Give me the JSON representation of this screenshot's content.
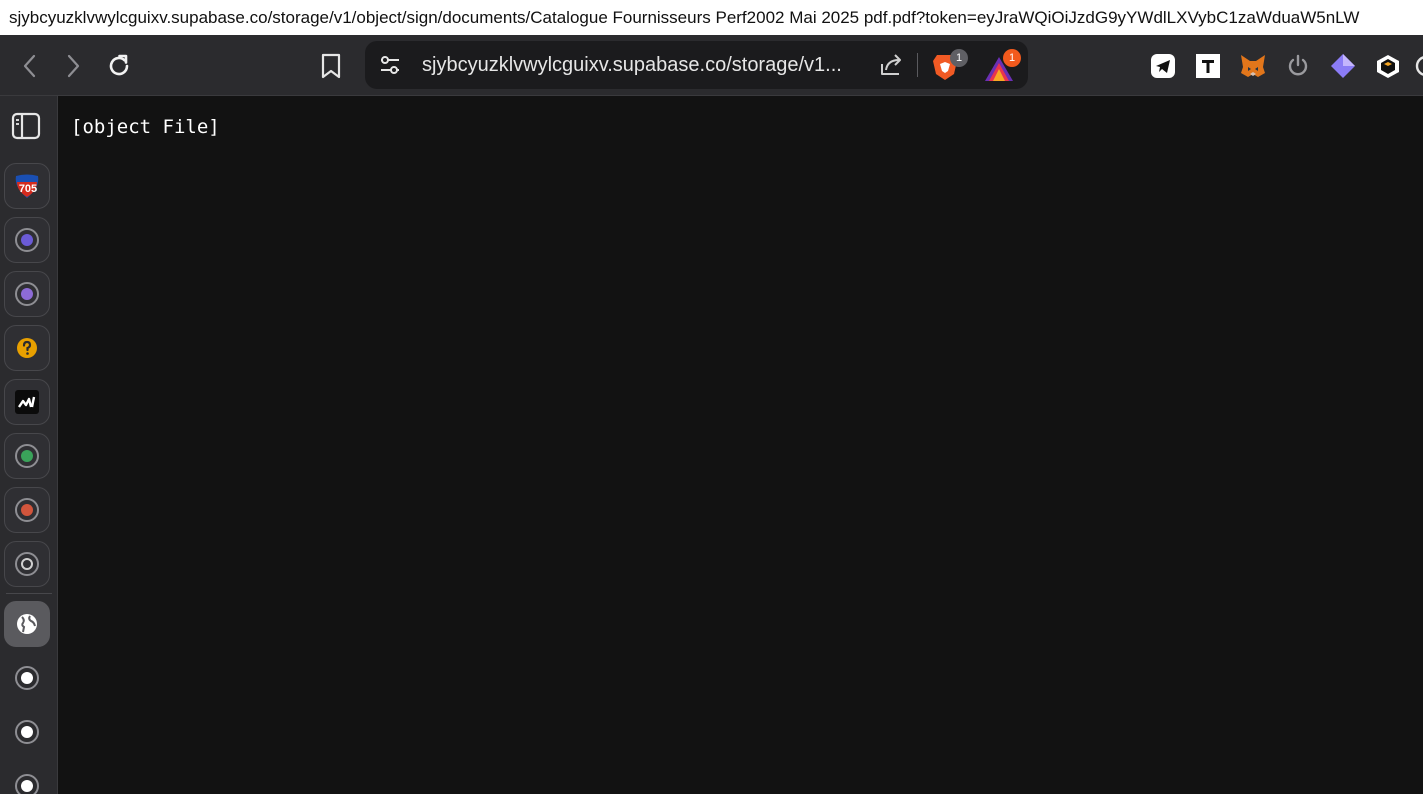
{
  "window": {
    "title": "sjybcyuzklvwylcguixv.supabase.co/storage/v1/object/sign/documents/Catalogue Fournisseurs Perf2002  Mai 2025 pdf.pdf?token=eyJraWQiOiJzdG9yYWdlLXVybC1zaWduaW5nLW"
  },
  "toolbar": {
    "back_icon": "chevron-left-icon",
    "forward_icon": "chevron-right-icon",
    "reload_icon": "reload-icon",
    "bookmark_icon": "bookmark-icon",
    "url": "sjybcyuzklvwylcguixv.supabase.co/storage/v1...",
    "shields_badge": "1",
    "rewards_badge": "1",
    "extensions": [
      "telegram-icon",
      "typora-t-icon",
      "metamask-fox-icon",
      "power-icon",
      "diamond-icon",
      "cube-wallet-icon"
    ]
  },
  "sidebar": {
    "items": [
      {
        "name": "sidebar-item-705",
        "badge": "705",
        "color": "#d52b1e"
      },
      {
        "name": "sidebar-item-app-2",
        "color": "#6b5bd6"
      },
      {
        "name": "sidebar-item-app-3",
        "color": "#8d6bd6"
      },
      {
        "name": "sidebar-item-help",
        "color": "#e8a000"
      },
      {
        "name": "sidebar-item-chart",
        "color": "#111111"
      },
      {
        "name": "sidebar-item-app-6",
        "color": "#3aa35a"
      },
      {
        "name": "sidebar-item-app-7",
        "color": "#d2553c"
      },
      {
        "name": "sidebar-item-app-8",
        "color": "#9a9a9a"
      },
      {
        "name": "sidebar-item-globe",
        "color": "#ffffff"
      },
      {
        "name": "sidebar-item-app-10",
        "color": "#ffffff"
      },
      {
        "name": "sidebar-item-app-11",
        "color": "#ffffff"
      },
      {
        "name": "sidebar-item-app-12",
        "color": "#ffffff"
      }
    ]
  },
  "page": {
    "text": "[object File]"
  }
}
